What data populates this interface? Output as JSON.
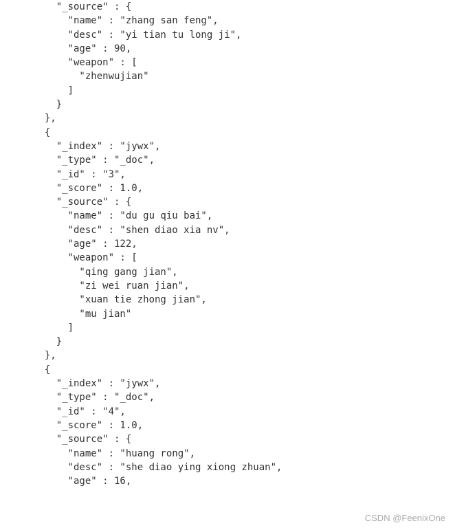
{
  "lines": [
    "    \"_source\" : {",
    "      \"name\" : \"zhang san feng\",",
    "      \"desc\" : \"yi tian tu long ji\",",
    "      \"age\" : 90,",
    "      \"weapon\" : [",
    "        \"zhenwujian\"",
    "      ]",
    "    }",
    "  },",
    "  {",
    "    \"_index\" : \"jywx\",",
    "    \"_type\" : \"_doc\",",
    "    \"_id\" : \"3\",",
    "    \"_score\" : 1.0,",
    "    \"_source\" : {",
    "      \"name\" : \"du gu qiu bai\",",
    "      \"desc\" : \"shen diao xia nv\",",
    "      \"age\" : 122,",
    "      \"weapon\" : [",
    "        \"qing gang jian\",",
    "        \"zi wei ruan jian\",",
    "        \"xuan tie zhong jian\",",
    "        \"mu jian\"",
    "      ]",
    "    }",
    "  },",
    "  {",
    "    \"_index\" : \"jywx\",",
    "    \"_type\" : \"_doc\",",
    "    \"_id\" : \"4\",",
    "    \"_score\" : 1.0,",
    "    \"_source\" : {",
    "      \"name\" : \"huang rong\",",
    "      \"desc\" : \"she diao ying xiong zhuan\",",
    "      \"age\" : 16,"
  ],
  "watermark": "CSDN @FeenixOne"
}
